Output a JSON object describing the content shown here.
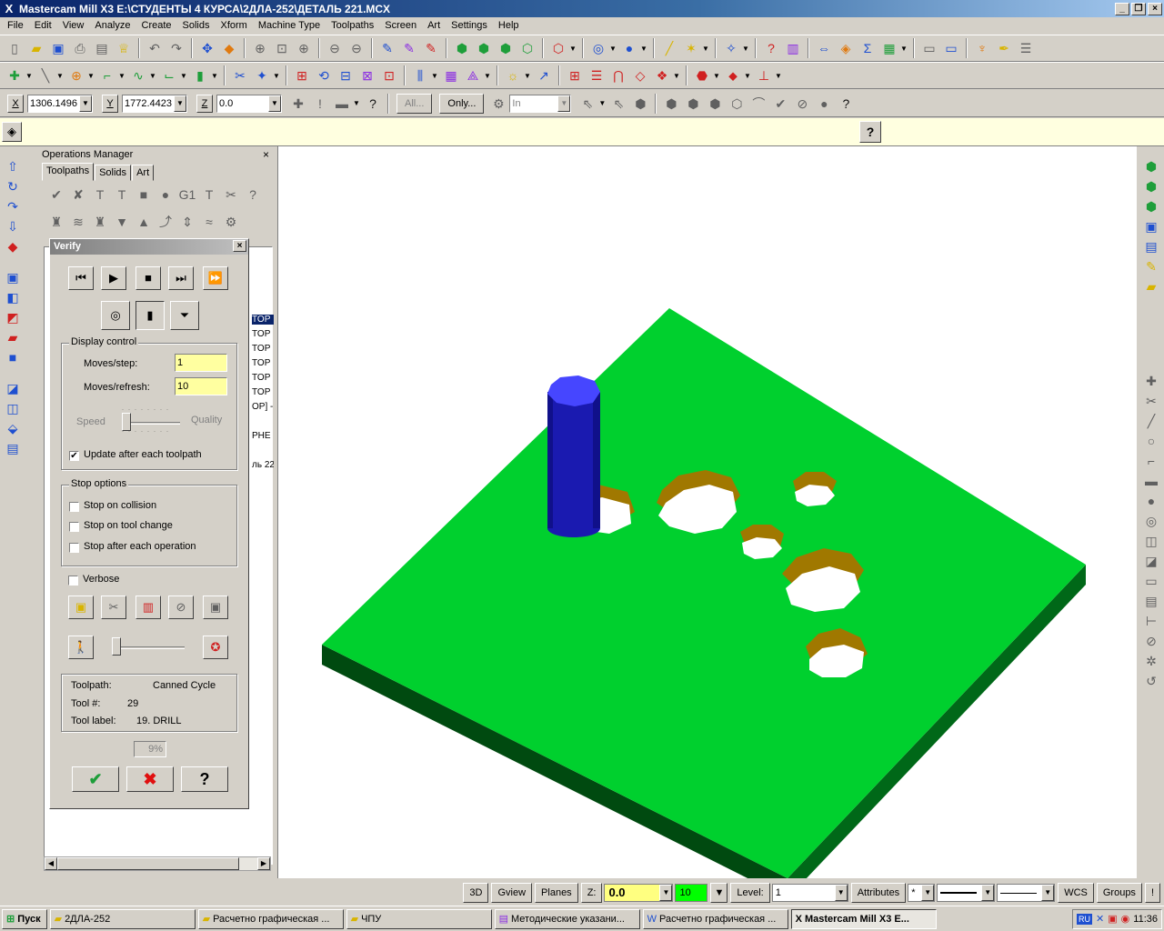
{
  "window": {
    "app_icon": "X",
    "title": "Mastercam Mill X3  E:\\СТУДЕНТЫ 4 КУРСА\\2ДЛА-252\\ДЕТАЛЬ 221.MCX",
    "minimize": "_",
    "restore": "❐",
    "close": "×"
  },
  "menu": [
    "File",
    "Edit",
    "View",
    "Analyze",
    "Create",
    "Solids",
    "Xform",
    "Machine Type",
    "Toolpaths",
    "Screen",
    "Art",
    "Settings",
    "Help"
  ],
  "coords": {
    "x_label": "X",
    "x_value": "1306.1496",
    "y_label": "Y",
    "y_value": "1772.4423",
    "z_label": "Z",
    "z_value": "0.0",
    "all_button": "All...",
    "only_button": "Only...",
    "units_placeholder": "In"
  },
  "ops_manager": {
    "title": "Operations Manager",
    "close": "×",
    "tabs": [
      "Toolpaths",
      "Solids",
      "Art"
    ],
    "tree_lines": [
      "TOP",
      "TOP",
      "TOP",
      "TOP",
      "TOP",
      "TOP",
      "OP] -",
      "PHE",
      "ль 22"
    ]
  },
  "verify": {
    "title": "Verify",
    "close": "×",
    "display_control": "Display control",
    "moves_step_label": "Moves/step:",
    "moves_step_value": "1",
    "moves_refresh_label": "Moves/refresh:",
    "moves_refresh_value": "10",
    "speed_label": "Speed",
    "quality_label": "Quality",
    "update_label": "Update after each toolpath",
    "stop_options": "Stop options",
    "stop_collision": "Stop on collision",
    "stop_tool_change": "Stop on tool change",
    "stop_each_op": "Stop after each operation",
    "verbose": "Verbose",
    "toolpath_label": "Toolpath:",
    "toolpath_value": "Canned Cycle",
    "tool_num_label": "Tool #:",
    "tool_num_value": "29",
    "tool_label_label": "Tool label:",
    "tool_label_value": "19. DRILL",
    "progress": "9%",
    "ok": "✔",
    "cancel": "✖",
    "help": "?"
  },
  "status": {
    "view_3d": "3D",
    "gview": "Gview",
    "planes": "Planes",
    "z_label": "Z:",
    "z_value": "0.0",
    "color_value": "10",
    "level_label": "Level:",
    "level_value": "1",
    "attributes": "Attributes",
    "point_style": "*",
    "wcs": "WCS",
    "groups": "Groups",
    "bang": "!"
  },
  "taskbar": {
    "start": "Пуск",
    "tasks": [
      {
        "label": "2ДЛА-252",
        "active": false
      },
      {
        "label": "Расчетно графическая ...",
        "active": false
      },
      {
        "label": "ЧПУ",
        "active": false
      },
      {
        "label": "Методические указани...",
        "active": false
      },
      {
        "label": "Расчетно графическая ...",
        "active": false
      },
      {
        "label": "Mastercam Mill X3  E...",
        "active": true
      }
    ],
    "lang": "RU",
    "clock": "11:36"
  },
  "colors": {
    "plate_top": "#00d02e",
    "plate_side": "#006818",
    "plate_front": "#004a10",
    "hole_wall": "#a07800",
    "tool_body": "#1a1ab0",
    "tool_top": "#4646ff"
  }
}
